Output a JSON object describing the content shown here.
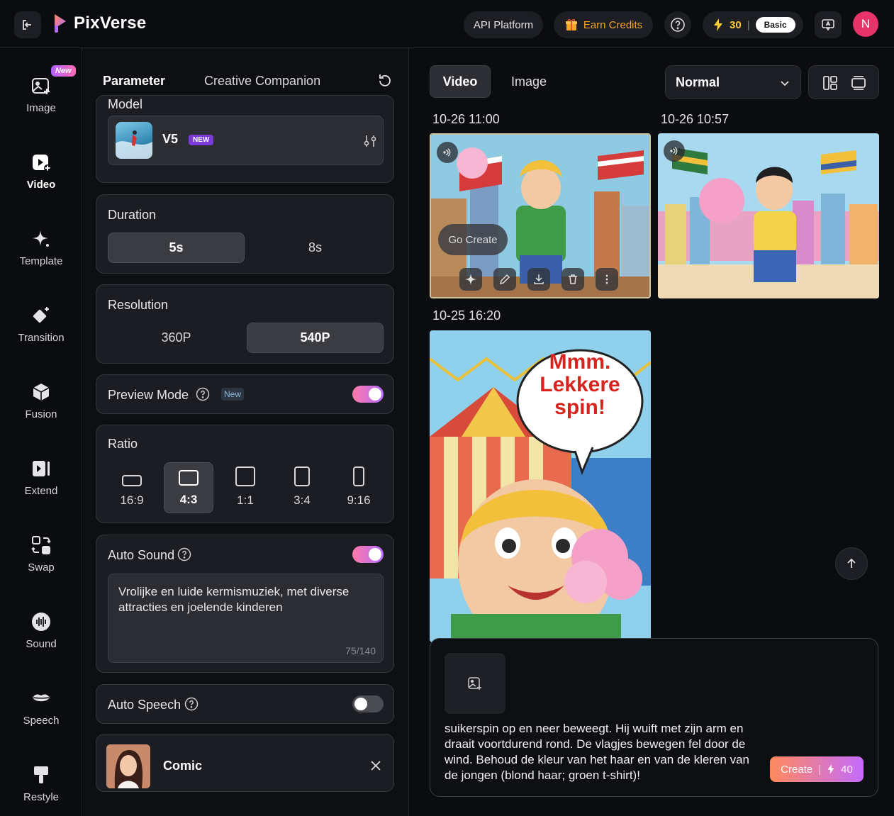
{
  "app": {
    "name": "PixVerse",
    "api_label": "API Platform",
    "earn_label": "Earn Credits",
    "credits": "30",
    "credits_sep": "|",
    "plan": "Basic",
    "avatar_initial": "N",
    "accent": "#b36cff"
  },
  "sidebar": {
    "items": [
      {
        "label": "Image",
        "icon": "image-plus-icon"
      },
      {
        "label": "Video",
        "icon": "video-plus-icon"
      },
      {
        "label": "Template",
        "icon": "sparkle-icon"
      },
      {
        "label": "Transition",
        "icon": "diamond-icon"
      },
      {
        "label": "Fusion",
        "icon": "cube-icon"
      },
      {
        "label": "Extend",
        "icon": "extend-icon"
      },
      {
        "label": "Swap",
        "icon": "swap-icon"
      },
      {
        "label": "Sound",
        "icon": "sound-wave-icon"
      },
      {
        "label": "Speech",
        "icon": "lips-icon"
      },
      {
        "label": "Restyle",
        "icon": "brush-icon"
      }
    ],
    "new_badge": "New",
    "active": "Video"
  },
  "panel": {
    "tabs": [
      "Parameter",
      "Creative Companion"
    ],
    "model": {
      "label": "Model",
      "name": "V5",
      "badge": "NEW"
    },
    "duration": {
      "label": "Duration",
      "options": [
        "5s",
        "8s"
      ],
      "selected": "5s"
    },
    "resolution": {
      "label": "Resolution",
      "options": [
        "360P",
        "540P"
      ],
      "selected": "540P"
    },
    "preview_mode": {
      "label": "Preview Mode",
      "badge": "New",
      "on": true
    },
    "ratio": {
      "label": "Ratio",
      "options": [
        "16:9",
        "4:3",
        "1:1",
        "3:4",
        "9:16"
      ],
      "selected": "4:3"
    },
    "auto_sound": {
      "label": "Auto Sound",
      "on": true,
      "text": "Vrolijke en luide kermismuziek, met diverse attracties en joelende kinderen",
      "count": "75/140"
    },
    "auto_speech": {
      "label": "Auto Speech",
      "on": false
    },
    "style": {
      "name": "Comic"
    }
  },
  "gallery": {
    "tabs": [
      "Video",
      "Image"
    ],
    "active_tab": "Video",
    "quality": "Normal",
    "items": [
      {
        "time": "10-26 11:00"
      },
      {
        "time": "10-26 10:57"
      },
      {
        "time": "10-25 16:20",
        "speech": [
          "Mmm.",
          "Lekkere",
          "spin!"
        ]
      }
    ],
    "go_create": "Go Create",
    "prompt_text": "suikerspin op en neer beweegt. Hij wuift met zijn arm en draait voortdurend rond. De vlagjes bewegen fel door de wind. Behoud de kleur van het haar en van de kleren van de jongen (blond haar; groen t-shirt)!",
    "create_label": "Create",
    "create_cost": "40"
  }
}
